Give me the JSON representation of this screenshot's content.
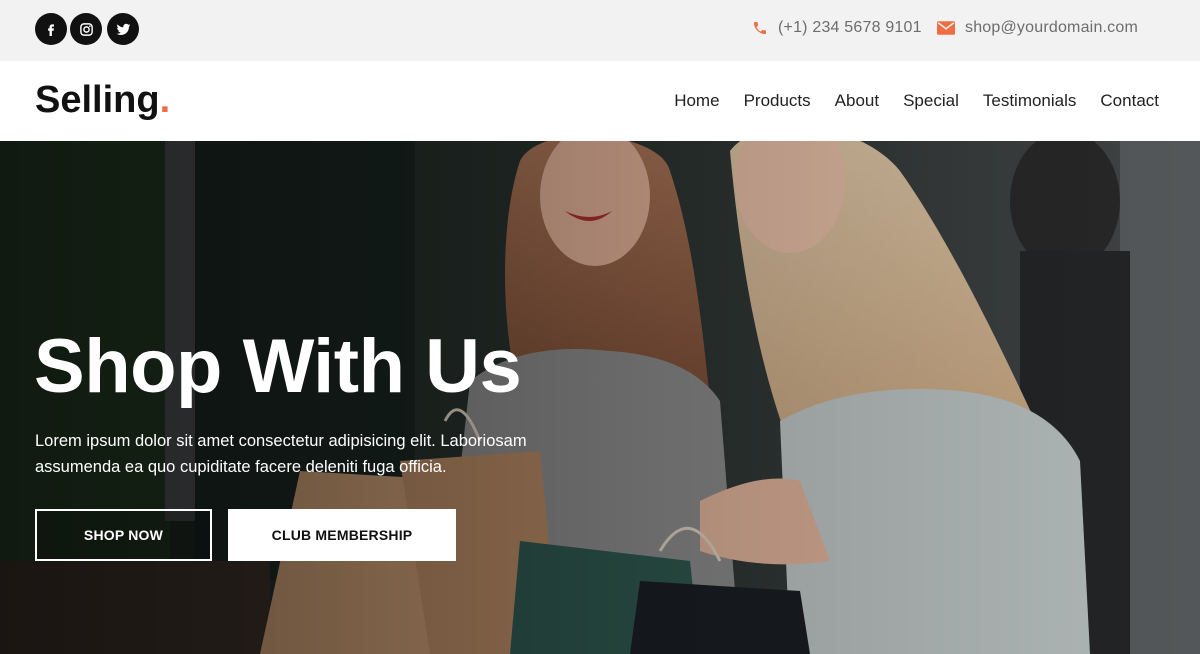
{
  "topbar": {
    "social": [
      {
        "name": "facebook-icon"
      },
      {
        "name": "instagram-icon"
      },
      {
        "name": "twitter-icon"
      }
    ],
    "phone": "(+1) 234 5678 9101",
    "email": "shop@yourdomain.com",
    "phone_icon": "phone-icon",
    "email_icon": "mail-icon"
  },
  "nav": {
    "logo": "Selling",
    "logo_dot": ".",
    "links": [
      "Home",
      "Products",
      "About",
      "Special",
      "Testimonials",
      "Contact"
    ]
  },
  "hero": {
    "title": "Shop With Us",
    "text": "Lorem ipsum dolor sit amet consectetur adipisicing elit. Laboriosam assumenda ea quo cupiditate facere deleniti fuga officia.",
    "shop_now": "SHOP NOW",
    "club_membership": "CLUB MEMBERSHIP"
  },
  "colors": {
    "accent": "#ef6d43",
    "topbar_bg": "#f2f2f2",
    "social_bg": "#111111"
  }
}
